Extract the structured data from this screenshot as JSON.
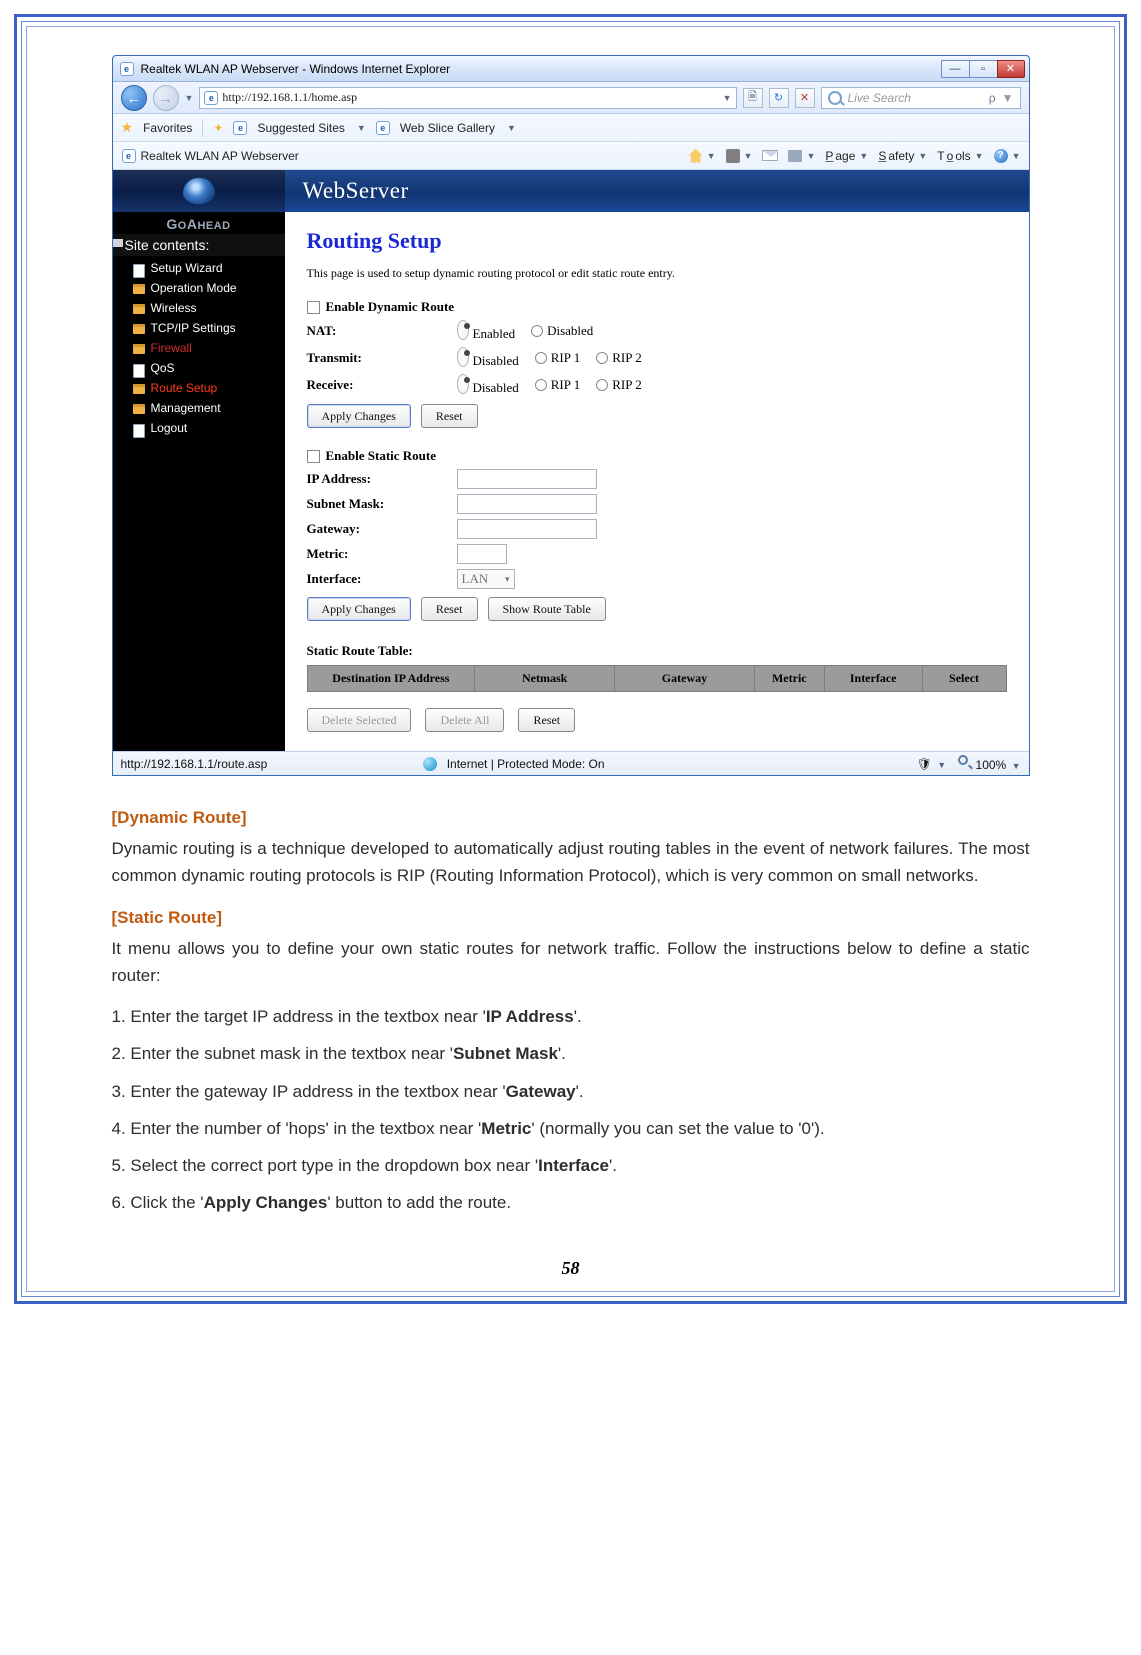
{
  "browser": {
    "window_title": "Realtek WLAN AP Webserver - Windows Internet Explorer",
    "url": "http://192.168.1.1/home.asp",
    "search_placeholder": "Live Search",
    "favorites_label": "Favorites",
    "suggested_sites": "Suggested Sites",
    "web_slice": "Web Slice Gallery",
    "tab_title": "Realtek WLAN AP Webserver",
    "commands": {
      "page": "Page",
      "safety": "Safety",
      "tools": "Tools"
    },
    "status_url": "http://192.168.1.1/route.asp",
    "status_mode": "Internet | Protected Mode: On",
    "zoom": "100%"
  },
  "sidebar": {
    "brand": "GOAHEAD",
    "header": "Site contents:",
    "items": [
      {
        "label": "Setup Wizard",
        "cls": "page"
      },
      {
        "label": "Operation Mode",
        "cls": ""
      },
      {
        "label": "Wireless",
        "cls": ""
      },
      {
        "label": "TCP/IP Settings",
        "cls": ""
      },
      {
        "label": "Firewall",
        "cls": "red"
      },
      {
        "label": "QoS",
        "cls": "page"
      },
      {
        "label": "Route Setup",
        "cls": "hot"
      },
      {
        "label": "Management",
        "cls": ""
      },
      {
        "label": "Logout",
        "cls": "page"
      }
    ]
  },
  "main": {
    "banner": "WebServer",
    "title": "Routing Setup",
    "desc": "This page is used to setup dynamic routing protocol or edit static route entry.",
    "dyn": {
      "enable": "Enable Dynamic Route",
      "nat": "NAT:",
      "nat_opts": [
        "Enabled",
        "Disabled"
      ],
      "tx": "Transmit:",
      "tx_opts": [
        "Disabled",
        "RIP 1",
        "RIP 2"
      ],
      "rx": "Receive:",
      "rx_opts": [
        "Disabled",
        "RIP 1",
        "RIP 2"
      ],
      "apply": "Apply Changes",
      "reset": "Reset"
    },
    "stat": {
      "enable": "Enable Static Route",
      "ip": "IP Address:",
      "mask": "Subnet Mask:",
      "gw": "Gateway:",
      "metric": "Metric:",
      "iface": "Interface:",
      "iface_val": "LAN",
      "apply": "Apply Changes",
      "reset": "Reset",
      "show": "Show Route Table"
    },
    "table": {
      "title": "Static Route Table:",
      "cols": [
        "Destination IP Address",
        "Netmask",
        "Gateway",
        "Metric",
        "Interface",
        "Select"
      ],
      "del_sel": "Delete Selected",
      "del_all": "Delete All",
      "reset": "Reset"
    }
  },
  "doc": {
    "sec1_head": "[Dynamic Route]",
    "sec1_body": "Dynamic routing is a technique developed to automatically adjust routing tables in the event of network failures. The most common dynamic routing protocols is RIP (Routing Information Protocol), which is very common on small networks.",
    "sec2_head": "[Static Route]",
    "sec2_body": "It menu allows you to define your own static routes for network traffic. Follow the instructions below to define a static router:",
    "steps": {
      "s1a": "1. Enter the target IP address in the textbox near '",
      "s1b": "IP Address",
      "s1c": "'.",
      "s2a": "2. Enter the subnet mask in the textbox near '",
      "s2b": "Subnet Mask",
      "s2c": "'.",
      "s3a": "3. Enter the gateway IP address in the textbox near '",
      "s3b": "Gateway",
      "s3c": "'.",
      "s4a": "4. Enter the number of 'hops' in the textbox near '",
      "s4b": "Metric",
      "s4c": "' (normally you can set the value to '0').",
      "s5a": "5. Select the correct port type in the dropdown box near '",
      "s5b": "Interface",
      "s5c": "'.",
      "s6a": "6. Click the '",
      "s6b": "Apply Changes",
      "s6c": "' button to add the route."
    },
    "page_number": "58"
  }
}
